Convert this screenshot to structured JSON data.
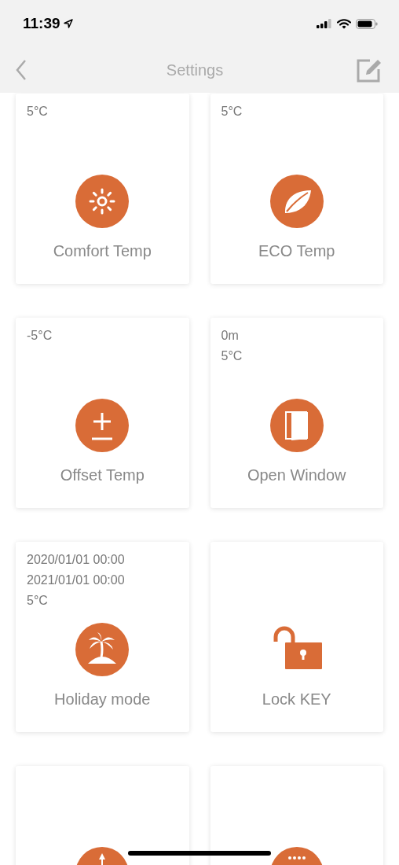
{
  "status_bar": {
    "time": "11:39"
  },
  "nav": {
    "title": "Settings"
  },
  "cards": [
    {
      "lines": [
        "5°C"
      ],
      "kind": "sun",
      "label": "Comfort Temp"
    },
    {
      "lines": [
        "5°C"
      ],
      "kind": "leaf",
      "label": "ECO Temp"
    },
    {
      "lines": [
        "-5°C"
      ],
      "kind": "plusminus",
      "label": "Offset Temp"
    },
    {
      "lines": [
        "0m",
        "5°C"
      ],
      "kind": "door",
      "label": "Open Window"
    },
    {
      "lines": [
        "2020/01/01 00:00",
        "2021/01/01 00:00",
        "5°C"
      ],
      "kind": "palm",
      "label": "Holiday mode"
    },
    {
      "kind": "lock",
      "label": "Lock KEY"
    },
    {
      "kind": "arrow"
    },
    {
      "kind": "dots"
    }
  ]
}
